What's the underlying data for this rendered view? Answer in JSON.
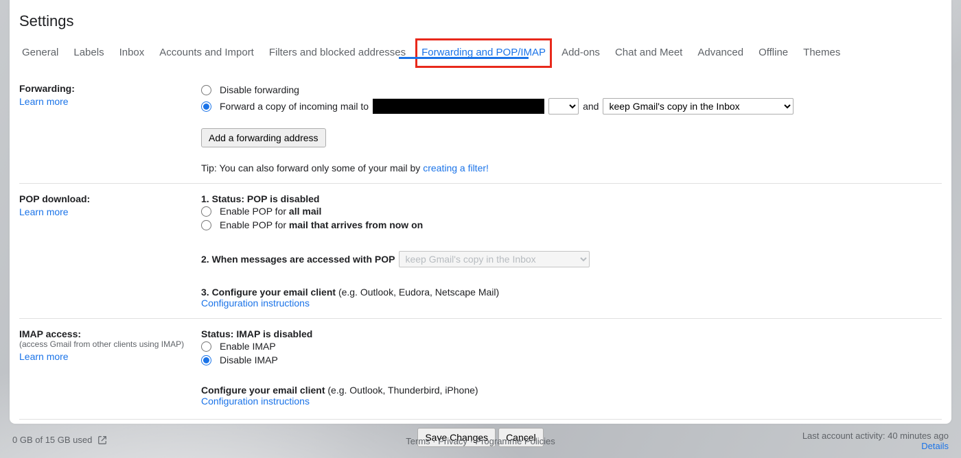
{
  "title": "Settings",
  "tabs": {
    "general": "General",
    "labels": "Labels",
    "inbox": "Inbox",
    "accounts": "Accounts and Import",
    "filters": "Filters and blocked addresses",
    "forwarding": "Forwarding and POP/IMAP",
    "addons": "Add-ons",
    "chat": "Chat and Meet",
    "advanced": "Advanced",
    "offline": "Offline",
    "themes": "Themes"
  },
  "forwarding": {
    "title": "Forwarding:",
    "learn": "Learn more",
    "disable": "Disable forwarding",
    "forward_copy": "Forward a copy of incoming mail to",
    "and": "and",
    "keep_copy_option": "keep Gmail's copy in the Inbox",
    "add_btn": "Add a forwarding address",
    "tip_prefix": "Tip: You can also forward only some of your mail by ",
    "tip_link": "creating a filter!"
  },
  "pop": {
    "title": "POP download:",
    "learn": "Learn more",
    "status_prefix": "1. Status: ",
    "status_bold": "POP is disabled",
    "opt_all_prefix": "Enable POP for ",
    "opt_all_bold": "all mail",
    "opt_now_prefix": "Enable POP for ",
    "opt_now_bold": "mail that arrives from now on",
    "when_label": "2. When messages are accessed with POP",
    "when_option": "keep Gmail's copy in the Inbox",
    "configure_bold": "3. Configure your email client ",
    "configure_rest": "(e.g. Outlook, Eudora, Netscape Mail)",
    "config_link": "Configuration instructions"
  },
  "imap": {
    "title": "IMAP access:",
    "subtitle": "(access Gmail from other clients using IMAP)",
    "learn": "Learn more",
    "status_prefix": "Status: ",
    "status_bold": "IMAP is disabled",
    "enable": "Enable IMAP",
    "disable": "Disable IMAP",
    "configure_bold": "Configure your email client ",
    "configure_rest": "(e.g. Outlook, Thunderbird, iPhone)",
    "config_link": "Configuration instructions"
  },
  "buttons": {
    "save": "Save Changes",
    "cancel": "Cancel"
  },
  "footer": {
    "storage": "0 GB of 15 GB used",
    "terms": "Terms",
    "privacy": "Privacy",
    "policies": "Programme Policies",
    "activity": "Last account activity: 40 minutes ago",
    "details": "Details"
  }
}
